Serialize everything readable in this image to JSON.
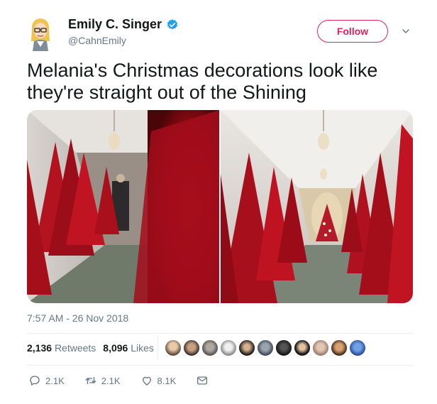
{
  "author": {
    "name": "Emily C. Singer",
    "handle": "@CahnEmily",
    "verified": true
  },
  "follow_label": "Follow",
  "tweet_text": "Melania's Christmas decorations look like they're straight out of the Shining",
  "timestamp": "7:57 AM - 26 Nov 2018",
  "stats": {
    "retweets_count": "2,136",
    "retweets_label": "Retweets",
    "likes_count": "8,096",
    "likes_label": "Likes"
  },
  "actions": {
    "replies": "2.1K",
    "retweets": "2.1K",
    "likes": "8.1K"
  },
  "colors": {
    "accent": "#e0245e",
    "verified": "#1da1f2",
    "muted": "#657786"
  },
  "icons": [
    "verified-badge-icon",
    "chevron-down-icon",
    "reply-icon",
    "retweet-icon",
    "like-icon",
    "message-icon"
  ]
}
